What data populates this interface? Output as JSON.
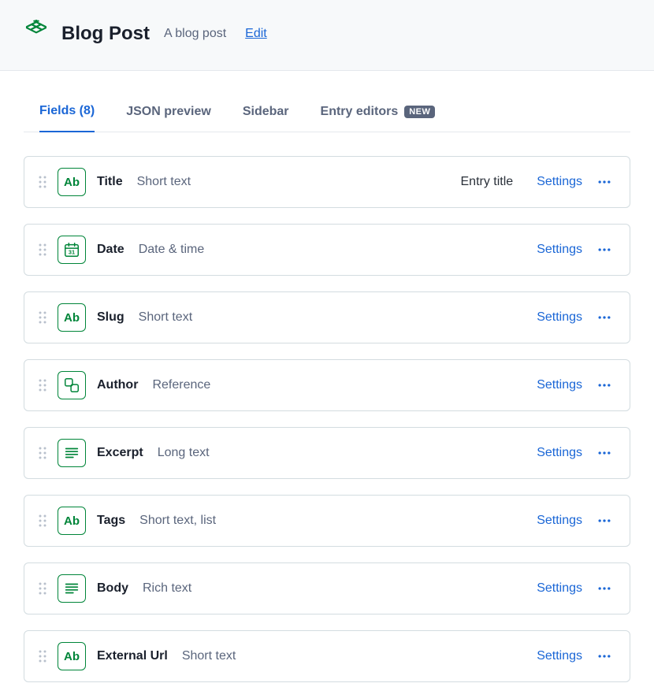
{
  "header": {
    "title": "Blog Post",
    "description": "A blog post",
    "edit": "Edit"
  },
  "tabs": [
    {
      "label": "Fields (8)",
      "active": true
    },
    {
      "label": "JSON preview",
      "active": false
    },
    {
      "label": "Sidebar",
      "active": false
    },
    {
      "label": "Entry editors",
      "active": false,
      "badge": "NEW"
    }
  ],
  "settingsLabel": "Settings",
  "fields": [
    {
      "name": "Title",
      "type": "Short text",
      "icon": "ab",
      "tag": "Entry title"
    },
    {
      "name": "Date",
      "type": "Date & time",
      "icon": "calendar"
    },
    {
      "name": "Slug",
      "type": "Short text",
      "icon": "ab"
    },
    {
      "name": "Author",
      "type": "Reference",
      "icon": "reference"
    },
    {
      "name": "Excerpt",
      "type": "Long text",
      "icon": "lines"
    },
    {
      "name": "Tags",
      "type": "Short text, list",
      "icon": "ab"
    },
    {
      "name": "Body",
      "type": "Rich text",
      "icon": "lines"
    },
    {
      "name": "External Url",
      "type": "Short text",
      "icon": "ab"
    }
  ]
}
